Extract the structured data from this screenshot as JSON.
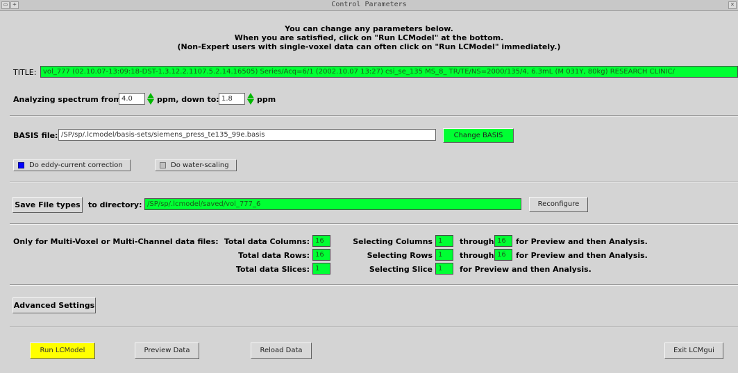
{
  "window": {
    "title": "Control Parameters"
  },
  "intro": {
    "line1": "You can change any parameters below.",
    "line2": "When you are satisfied, click on \"Run LCModel\" at the bottom.",
    "line3": "(Non-Expert users with single-voxel data can often click on \"Run LCModel\" immediately.)"
  },
  "title_row": {
    "label": "TITLE:",
    "value": "vol_777 (02.10.07-13:09:18-DST-1.3.12.2.1107.5.2.14.16505) Series/Acq=6/1 (2002.10.07 13:27) csi_se_135 MS_8_  TR/TE/NS=2000/135/4,  6.3mL (M 031Y, 80kg) RESEARCH CLINIC/"
  },
  "ppm": {
    "label_from": "Analyzing spectrum from:",
    "from_value": "4.0",
    "label_mid": "ppm, down to:",
    "to_value": "1.8",
    "label_end": "ppm"
  },
  "basis": {
    "label": "BASIS file:",
    "path": "/SP/sp/.lcmodel/basis-sets/siemens_press_te135_99e.basis",
    "change_button": "Change BASIS"
  },
  "options": {
    "eddy": {
      "label": "Do eddy-current correction",
      "checked": true
    },
    "water": {
      "label": "Do water-scaling",
      "checked": false
    }
  },
  "save": {
    "button": "Save File types",
    "to_dir_label": "to directory:",
    "directory": "/SP/sp/.lcmodel/saved/vol_777_6",
    "reconfigure": "Reconfigure"
  },
  "multivoxel": {
    "heading": "Only for Multi-Voxel or Multi-Channel data files:",
    "total_columns_label": "Total data Columns:",
    "total_columns": "16",
    "total_rows_label": "Total data Rows:",
    "total_rows": "16",
    "total_slices_label": "Total data Slices:",
    "total_slices": "1",
    "sel_columns_label": "Selecting Columns",
    "sel_columns_from": "1",
    "sel_columns_to": "16",
    "sel_rows_label": "Selecting Rows",
    "sel_rows_from": "1",
    "sel_rows_to": "16",
    "sel_slice_label": "Selecting Slice",
    "sel_slice": "1",
    "through": "through",
    "for_preview": "for Preview and then Analysis."
  },
  "advanced": {
    "button": "Advanced Settings"
  },
  "actions": {
    "run": "Run LCModel",
    "preview": "Preview Data",
    "reload": "Reload Data",
    "exit": "Exit LCMgui"
  },
  "colors": {
    "field_green": "#00ff33",
    "run_yellow": "#ffff00",
    "checkbox_blue": "#0000ff"
  }
}
